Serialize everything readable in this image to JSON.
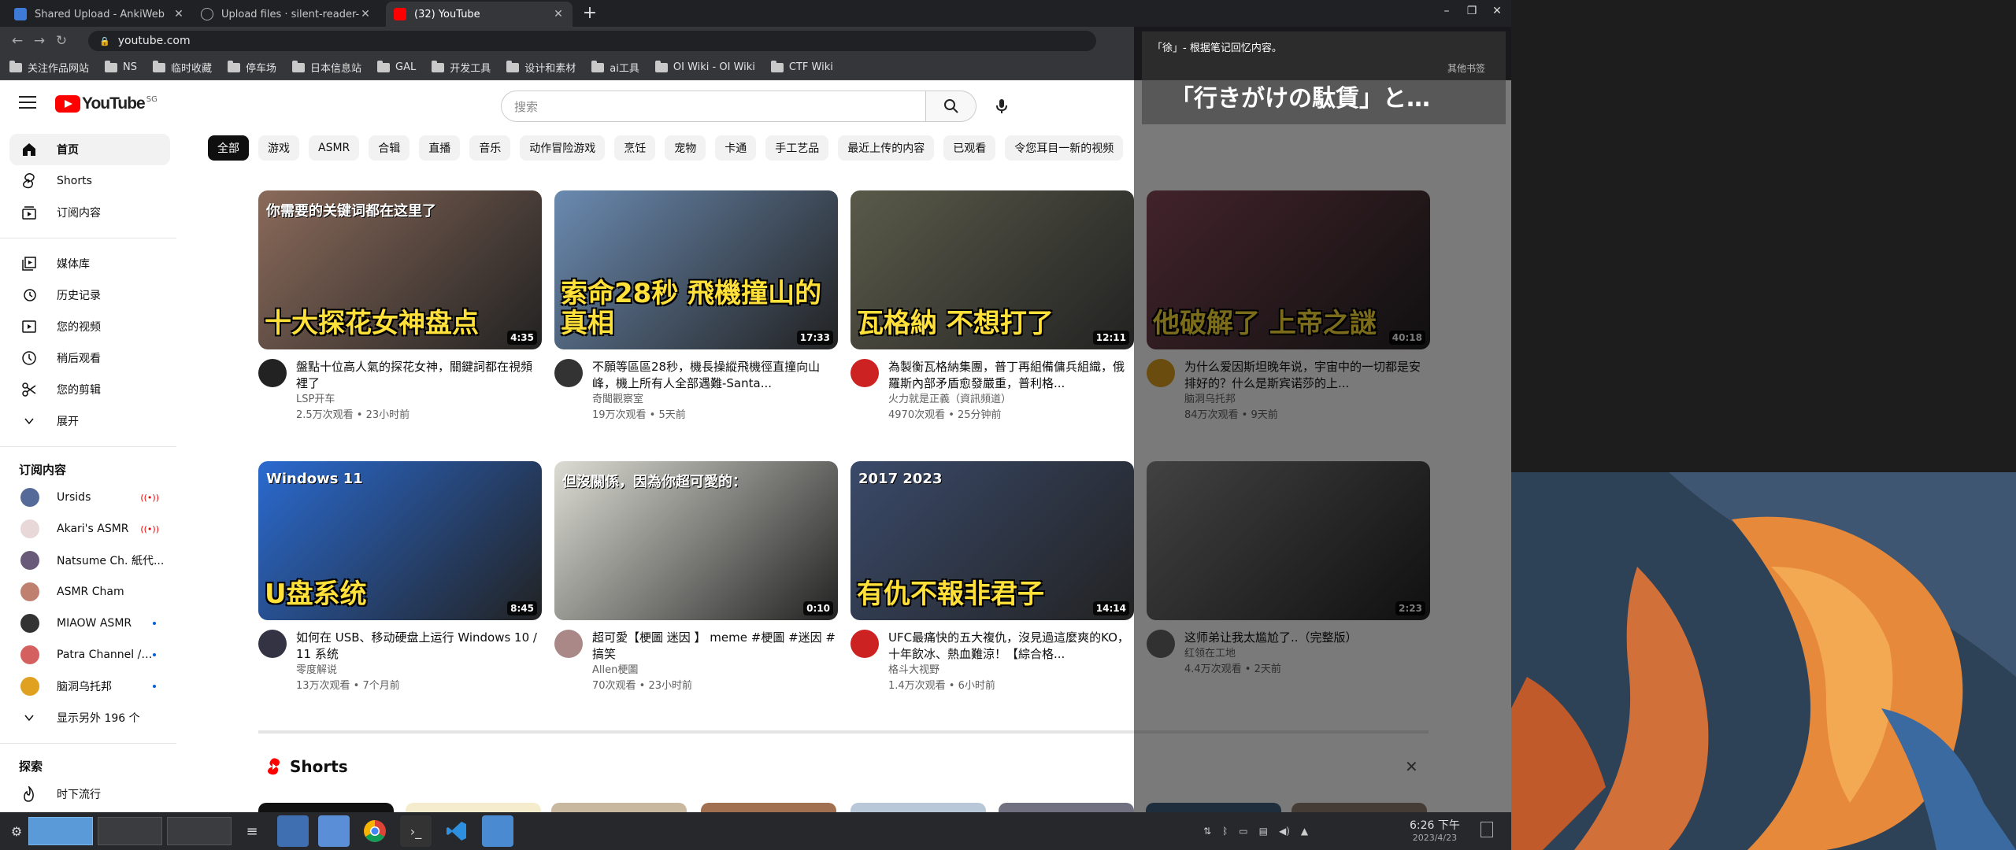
{
  "tabs": [
    {
      "title": "Shared Upload - AnkiWeb",
      "color": "#3d7bd6"
    },
    {
      "title": "Upload files · silent-reader-cn",
      "color": "#222"
    },
    {
      "title": "(32) YouTube",
      "color": "#ff0000"
    }
  ],
  "address": "youtube.com",
  "bookmarks": [
    "关注作品网站",
    "NS",
    "临时收藏",
    "停车场",
    "日本信息站",
    "GAL",
    "开发工具",
    "设计和素材",
    "ai工具",
    "OI Wiki - OI Wiki",
    "CTF Wiki"
  ],
  "other_bookmarks": "其他书签",
  "masthead": {
    "logo": "YouTube",
    "region": "SG",
    "search_placeholder": "搜索"
  },
  "sidebar": {
    "main": [
      {
        "label": "首页",
        "icon": "home-icon",
        "active": true
      },
      {
        "label": "Shorts",
        "icon": "shorts-icon"
      },
      {
        "label": "订阅内容",
        "icon": "subscriptions-icon"
      }
    ],
    "you": [
      {
        "label": "媒体库",
        "icon": "library-icon"
      },
      {
        "label": "历史记录",
        "icon": "history-icon"
      },
      {
        "label": "您的视频",
        "icon": "your-videos-icon"
      },
      {
        "label": "稍后观看",
        "icon": "watch-later-icon"
      },
      {
        "label": "您的剪辑",
        "icon": "clips-icon"
      },
      {
        "label": "展开",
        "icon": "chevron-down-icon"
      }
    ],
    "subs_heading": "订阅内容",
    "subs": [
      {
        "label": "Ursids",
        "status": "live",
        "color": "#556a99"
      },
      {
        "label": "Akari's ASMR",
        "status": "live",
        "color": "#e8d8d8"
      },
      {
        "label": "Natsume Ch. 紙代...",
        "status": "",
        "color": "#6a5a7a"
      },
      {
        "label": "ASMR Cham",
        "status": "",
        "color": "#c08070"
      },
      {
        "label": "MIAOW ASMR",
        "status": "new",
        "color": "#333"
      },
      {
        "label": "Patra Channel / ...",
        "status": "new",
        "color": "#d46060"
      },
      {
        "label": "脑洞乌托邦",
        "status": "new",
        "color": "#e0a020"
      }
    ],
    "show_more": "显示另外 196 个",
    "explore_heading": "探索",
    "explore": [
      {
        "label": "时下流行",
        "icon": "trending-icon"
      }
    ]
  },
  "chips": [
    "全部",
    "游戏",
    "ASMR",
    "合辑",
    "直播",
    "音乐",
    "动作冒险游戏",
    "烹饪",
    "宠物",
    "卡通",
    "手工艺品",
    "最近上传的内容",
    "已观看",
    "令您耳目一新的视频"
  ],
  "videos": [
    {
      "title": "盤點十位高人氣的探花女神，關鍵詞都在視頻裡了",
      "channel": "LSP开车",
      "stats": "2.5万次观看 • 23小时前",
      "duration": "4:35",
      "thumb_text": "十大探花女神盘点",
      "thumb_sub": "你需要的关键词都在这里了",
      "bg": "#8a6a5a",
      "av": "#222"
    },
    {
      "title": "不願等區區28秒，機長操縱飛機徑直撞向山峰，機上所有人全部遇難-Santa...",
      "channel": "奇聞觀察室",
      "stats": "19万次观看 • 5天前",
      "duration": "17:33",
      "thumb_text": "索命28秒 飛機撞山的真相",
      "thumb_sub": "",
      "bg": "#6a8ab0",
      "av": "#333"
    },
    {
      "title": "為製衡瓦格納集團，普丁再組備傭兵組織，俄羅斯內部矛盾愈發嚴重，普利格...",
      "channel": "火力就是正義（資訊頻道）",
      "stats": "4970次观看 • 25分钟前",
      "duration": "12:11",
      "thumb_text": "瓦格納 不想打了",
      "thumb_sub": "",
      "bg": "#5a5a4a",
      "av": "#cc2222"
    },
    {
      "title": "为什么爱因斯坦晚年说，宇宙中的一切都是安排好的？什么是斯宾诺莎的上...",
      "channel": "脑洞乌托邦",
      "stats": "84万次观看 • 9天前",
      "duration": "40:18",
      "thumb_text": "他破解了 上帝之謎",
      "thumb_sub": "",
      "bg": "#8a4a5a",
      "av": "#e0a020"
    },
    {
      "title": "如何在 USB、移动硬盘上运行 Windows 10 / 11 系统",
      "channel": "零度解说",
      "stats": "13万次观看 • 7个月前",
      "duration": "8:45",
      "thumb_text": "U盘系统",
      "thumb_sub": "Windows 11",
      "bg": "#2a6ad0",
      "av": "#334"
    },
    {
      "title": "超可愛【梗圖 迷因 】 meme #梗圖 #迷因 #搞笑",
      "channel": "Allen梗圖",
      "stats": "70次观看 • 23小时前",
      "duration": "0:10",
      "thumb_text": "",
      "thumb_sub": "但沒關係，因為你超可愛的：",
      "bg": "#dcdcd4",
      "av": "#a88"
    },
    {
      "title": "UFC最痛快的五大複仇，沒見過這麼爽的KO，十年飲冰、熱血難涼！【綜合格...",
      "channel": "格斗大视野",
      "stats": "1.4万次观看 • 6小时前",
      "duration": "14:14",
      "thumb_text": "有仇不報非君子",
      "thumb_sub": "2017 2023",
      "bg": "#3a4a6a",
      "av": "#cc2222"
    },
    {
      "title": "这师弟让我太尴尬了..（完整版）",
      "channel": "红领在工地",
      "stats": "4.4万次观看 • 2天前",
      "duration": "2:23",
      "thumb_text": "",
      "thumb_sub": "",
      "bg": "#8a8a8a",
      "av": "#666"
    }
  ],
  "shorts_heading": "Shorts",
  "overlay": {
    "small": "「徐」- 根据笔记回忆内容。",
    "big": "「行きがけの駄賃」と…"
  },
  "clock": {
    "time": "6:26 下午",
    "date": "2023/4/23"
  }
}
